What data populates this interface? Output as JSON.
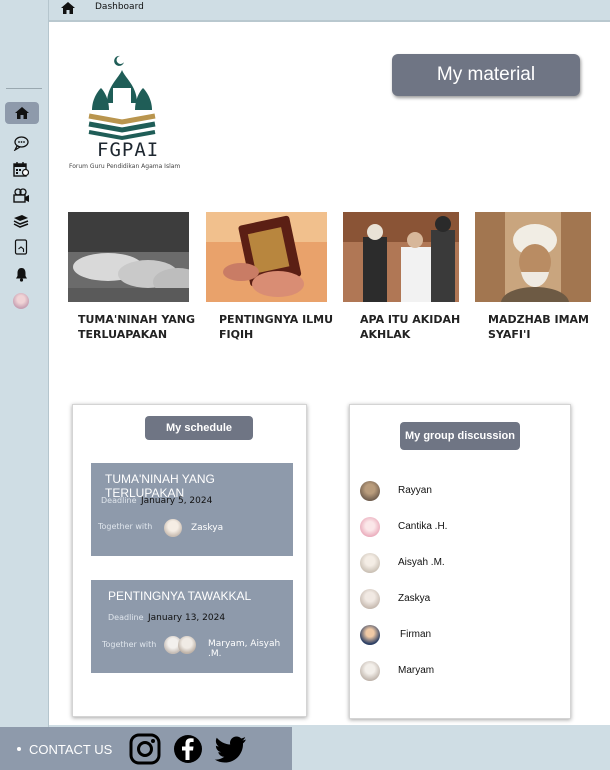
{
  "topbar": {
    "breadcrumb": "Dashboard"
  },
  "logo": {
    "name": "FGPAI",
    "subtitle": "Forum Guru Pendidikan Agama Islam"
  },
  "my_material_label": "My material",
  "materials": [
    {
      "title_line1": "TUMA'NINAH YANG",
      "title_line2": "TERLUAPAKAN"
    },
    {
      "title_line1": "PENTINGNYA ILMU",
      "title_line2": "FIQIH"
    },
    {
      "title_line1": "APA ITU AKIDAH",
      "title_line2": "AKHLAK"
    },
    {
      "title_line1": "MADZHAB IMAM",
      "title_line2": "SYAFI'I"
    }
  ],
  "schedule": {
    "heading": "My schedule",
    "tasks": [
      {
        "title": "TUMA'NINAH YANG TERLUPAKAN",
        "deadline_label": "Deadline",
        "deadline": "January 5, 2024",
        "together_label": "Together with",
        "members": "Zaskya"
      },
      {
        "title": "PENTINGNYA TAWAKKAL",
        "deadline_label": "Deadline",
        "deadline": "January 13, 2024",
        "together_label": "Together with",
        "members": "Maryam, Aisyah .M."
      }
    ]
  },
  "group": {
    "heading": "My group discussion",
    "members": [
      "Rayyan",
      "Cantika .H.",
      "Aisyah .M.",
      "Zaskya",
      "Firman",
      "Maryam"
    ]
  },
  "footer": {
    "contact_label": "CONTACT US"
  },
  "colors": {
    "sidebar_bg": "#cfdde4",
    "accent": "#8e9aab",
    "button_dark": "#6f7584",
    "logo_green": "#1f5d57",
    "logo_gold": "#b9954e"
  }
}
